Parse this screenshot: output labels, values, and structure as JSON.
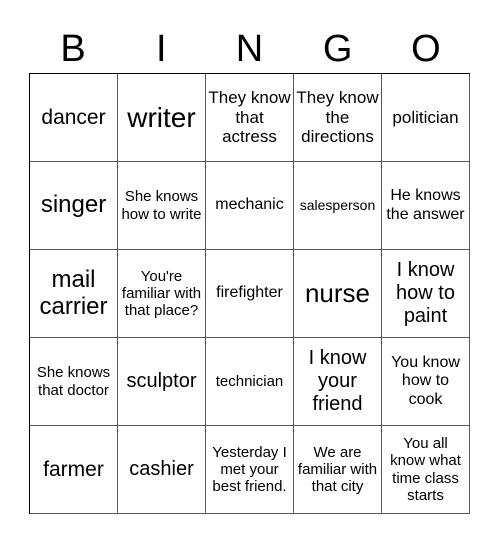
{
  "header": {
    "letters": [
      "B",
      "I",
      "N",
      "G",
      "O"
    ]
  },
  "cells": [
    [
      "dancer",
      "writer",
      "They know that actress",
      "They know the directions",
      "politician"
    ],
    [
      "singer",
      "She knows how to write",
      "mechanic",
      "salesperson",
      "He knows the answer"
    ],
    [
      "mail carrier",
      "You're familiar with that place?",
      "firefighter",
      "nurse",
      "I know how to paint"
    ],
    [
      "She knows that doctor",
      "sculptor",
      "technician",
      "I know your friend",
      "You know how to cook"
    ],
    [
      "farmer",
      "cashier",
      "Yesterday I met your best friend.",
      "We are familiar with that city",
      "You all know what time class starts"
    ]
  ]
}
